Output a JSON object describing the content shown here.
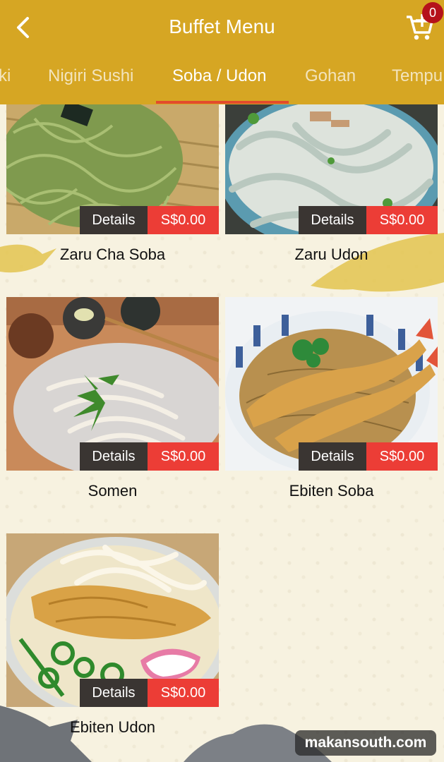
{
  "header": {
    "title": "Buffet Menu",
    "cart_count": "0"
  },
  "tabs": [
    "ki",
    "Nigiri Sushi",
    "Soba / Udon",
    "Gohan",
    "Tempu"
  ],
  "active_tab": "Soba / Udon",
  "items": [
    {
      "name": "Zaru Cha Soba",
      "details_label": "Details",
      "price": "S$0.00"
    },
    {
      "name": "Zaru Udon",
      "details_label": "Details",
      "price": "S$0.00"
    },
    {
      "name": "Somen",
      "details_label": "Details",
      "price": "S$0.00"
    },
    {
      "name": "Ebiten Soba",
      "details_label": "Details",
      "price": "S$0.00"
    },
    {
      "name": "Ebiten Udon",
      "details_label": "Details",
      "price": "S$0.00"
    }
  ],
  "watermark": "makansouth.com",
  "colors": {
    "header": "#d6a623",
    "active_underline": "#e34b2c",
    "price_bg": "#ec3d36",
    "details_bg": "#3a3532",
    "badge": "#b5121b"
  },
  "icons": {
    "back": "chevron-left-icon",
    "cart": "cart-add-icon"
  }
}
